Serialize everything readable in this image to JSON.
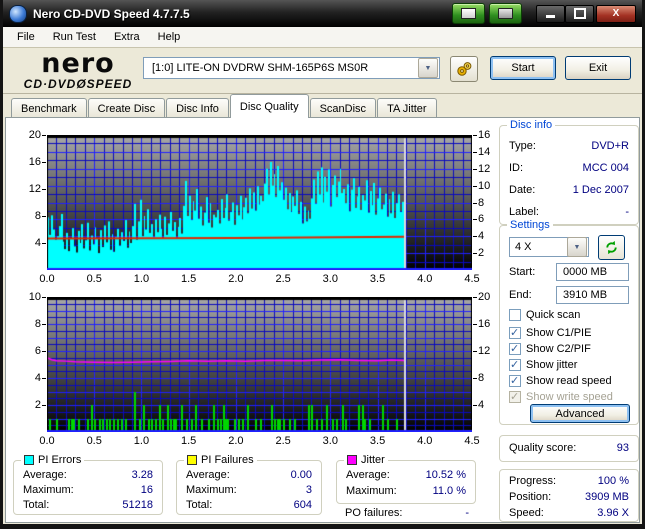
{
  "window": {
    "title": "Nero CD-DVD Speed 4.7.7.5"
  },
  "icons": {
    "app_icon": "nero-disc",
    "titlebar_left": "capture-window-icon",
    "titlebar_right": "save-disk-icon",
    "minimize": "minimize-icon",
    "maximize": "maximize-icon",
    "close": "close-icon",
    "options": "gears-icon",
    "refresh": "refresh-arrows-icon",
    "combo_arrow": "▼"
  },
  "menu": {
    "items": [
      "File",
      "Run Test",
      "Extra",
      "Help"
    ]
  },
  "toolbar": {
    "logo_line1": "nero",
    "logo_line2": "CD·DVDØSPEED",
    "drive": "[1:0]   LITE-ON DVDRW SHM-165P6S MS0R",
    "start_label": "Start",
    "exit_label": "Exit"
  },
  "tabs": {
    "items": [
      "Benchmark",
      "Create Disc",
      "Disc Info",
      "Disc Quality",
      "ScanDisc",
      "TA Jitter"
    ],
    "selected": "Disc Quality"
  },
  "disc_info": {
    "title": "Disc info",
    "rows": [
      {
        "label": "Type:",
        "value": "DVD+R"
      },
      {
        "label": "ID:",
        "value": "MCC 004"
      },
      {
        "label": "Date:",
        "value": "1 Dec 2007"
      },
      {
        "label": "Label:",
        "value": "-"
      }
    ]
  },
  "settings": {
    "title": "Settings",
    "speed_value": "4 X",
    "start_label": "Start:",
    "start_value": "0000 MB",
    "end_label": "End:",
    "end_value": "3910 MB",
    "checkboxes": [
      {
        "label": "Quick scan",
        "checked": false,
        "enabled": true
      },
      {
        "label": "Show C1/PIE",
        "checked": true,
        "enabled": true
      },
      {
        "label": "Show C2/PIF",
        "checked": true,
        "enabled": true
      },
      {
        "label": "Show jitter",
        "checked": true,
        "enabled": true
      },
      {
        "label": "Show read speed",
        "checked": true,
        "enabled": true
      },
      {
        "label": "Show write speed",
        "checked": true,
        "enabled": false
      }
    ],
    "advanced_label": "Advanced"
  },
  "quality": {
    "label": "Quality score:",
    "value": "93"
  },
  "progress": {
    "rows": [
      {
        "label": "Progress:",
        "value": "100 %"
      },
      {
        "label": "Position:",
        "value": "3909 MB"
      },
      {
        "label": "Speed:",
        "value": "3.96 X"
      }
    ]
  },
  "stats": {
    "pi_errors": {
      "title": "PI Errors",
      "swatch": "#00FFFF",
      "rows": [
        [
          "Average:",
          "3.28"
        ],
        [
          "Maximum:",
          "16"
        ],
        [
          "Total:",
          "51218"
        ]
      ]
    },
    "pi_failures": {
      "title": "PI Failures",
      "swatch": "#FFFF00",
      "rows": [
        [
          "Average:",
          "0.00"
        ],
        [
          "Maximum:",
          "3"
        ],
        [
          "Total:",
          "604"
        ]
      ]
    },
    "jitter": {
      "title": "Jitter",
      "swatch": "#FF00FF",
      "rows": [
        [
          "Average:",
          "10.52 %"
        ],
        [
          "Maximum:",
          "11.0 %"
        ]
      ],
      "po_label": "PO failures:",
      "po_value": "-"
    }
  },
  "chart_data": [
    {
      "type": "area",
      "name": "pi-errors-vs-position",
      "xlim": [
        0,
        4.5
      ],
      "x_ticks": [
        0,
        0.5,
        1,
        1.5,
        2,
        2.5,
        3,
        3.5,
        4,
        4.5
      ],
      "ylim_left": [
        0,
        20
      ],
      "left_ticks": [
        4,
        8,
        12,
        16,
        20
      ],
      "ylim_right": [
        0,
        16
      ],
      "right_ticks": [
        2,
        4,
        6,
        8,
        10,
        12,
        14,
        16
      ],
      "grid_rows": 16,
      "grid_cols": 45,
      "bg_top": "#A9A9A9",
      "bg_bottom": "#000000",
      "grid_minor": "#0A0ABE",
      "grid_major": "#2121FF",
      "data_end_x": 3.79,
      "cursor_x": 3.79,
      "cursor_color": "#DCDCDC",
      "series": [
        {
          "name": "PI Errors",
          "render": "fill",
          "axis": "left",
          "color": "#00FFFF",
          "values": [
            7.8,
            5.2,
            8.1,
            6.0,
            4.5,
            5.0,
            6.5,
            8.3,
            4.2,
            3.1,
            5.5,
            2.8,
            4.6,
            6.2,
            3.5,
            2.6,
            5.8,
            4.0,
            6.8,
            3.2,
            4.4,
            7.0,
            2.9,
            5.1,
            3.8,
            6.3,
            4.7,
            2.5,
            5.9,
            3.4,
            6.6,
            4.1,
            7.2,
            3.0,
            5.3,
            2.7,
            4.9,
            6.1,
            3.6,
            5.6,
            4.3,
            7.4,
            3.3,
            5.7,
            4.0,
            6.5,
            9.8,
            4.5,
            7.2,
            10.4,
            5.0,
            8.0,
            6.0,
            9.0,
            5.5,
            6.8,
            4.9,
            7.5,
            5.6,
            8.2,
            6.1,
            4.6,
            7.9,
            5.2,
            6.9,
            8.6,
            5.8,
            7.1,
            4.8,
            6.4,
            7.7,
            5.4,
            9.5,
            13.2,
            8.0,
            11.0,
            7.4,
            10.2,
            8.8,
            12.0,
            7.6,
            9.4,
            6.6,
            8.5,
            10.8,
            7.0,
            9.9,
            6.3,
            8.2,
            7.8,
            8.9,
            6.9,
            10.5,
            7.7,
            9.2,
            11.2,
            7.3,
            8.6,
            10.0,
            6.7,
            9.6,
            8.1,
            11.0,
            7.5,
            9.3,
            10.7,
            8.4,
            12.1,
            9.1,
            11.5,
            8.8,
            12.4,
            9.7,
            11.0,
            10.2,
            12.8,
            15.0,
            11.2,
            16.0,
            12.5,
            14.2,
            10.8,
            15.4,
            11.8,
            13.0,
            10.4,
            12.2,
            9.0,
            11.4,
            8.6,
            10.9,
            9.5,
            11.8,
            8.3,
            10.1,
            6.9,
            9.4,
            7.2,
            8.8,
            7.6,
            10.6,
            13.4,
            9.8,
            14.6,
            11.2,
            15.2,
            10.0,
            13.8,
            11.6,
            14.9,
            9.4,
            12.6,
            14.0,
            10.8,
            13.1,
            15.0,
            11.4,
            12.0,
            9.9,
            12.7,
            8.7,
            11.9,
            13.6,
            9.2,
            10.9,
            12.3,
            8.9,
            11.1,
            10.3,
            13.3,
            8.5,
            11.7,
            9.6,
            12.9,
            8.2,
            10.6,
            12.2,
            9.0,
            9.7,
            11.3,
            7.9,
            10.5,
            8.4,
            11.6,
            7.7,
            9.9,
            11.2,
            8.6,
            10.1,
            11.0
          ]
        },
        {
          "name": "Read speed",
          "render": "line",
          "axis": "right",
          "color": "#E02800",
          "width": 2,
          "points": [
            [
              0,
              3.73
            ],
            [
              2.0,
              3.8
            ],
            [
              3.79,
              3.93
            ]
          ]
        }
      ]
    },
    {
      "type": "bars+line",
      "name": "pi-failures-and-jitter-vs-position",
      "xlim": [
        0,
        4.5
      ],
      "x_ticks": [
        0,
        0.5,
        1,
        1.5,
        2,
        2.5,
        3,
        3.5,
        4,
        4.5
      ],
      "ylim_left": [
        0,
        10
      ],
      "left_ticks": [
        2,
        4,
        6,
        8,
        10
      ],
      "ylim_right": [
        0,
        20
      ],
      "right_ticks": [
        4,
        8,
        12,
        16,
        20
      ],
      "grid_rows": 20,
      "grid_cols": 45,
      "bg_top": "#A9A9A9",
      "bg_bottom": "#000000",
      "grid_minor": "#0A0ABE",
      "grid_major": "#2121FF",
      "data_end_x": 3.79,
      "cursor_x": 3.79,
      "cursor_color": "#DCDCDC",
      "series": [
        {
          "name": "PI Failures",
          "render": "bars",
          "axis": "left",
          "color": "#00D800",
          "bars": [
            [
              0.02,
              1
            ],
            [
              0.1,
              1
            ],
            [
              0.22,
              1
            ],
            [
              0.25,
              1
            ],
            [
              0.28,
              1
            ],
            [
              0.33,
              1
            ],
            [
              0.42,
              1
            ],
            [
              0.47,
              2
            ],
            [
              0.5,
              1
            ],
            [
              0.55,
              1
            ],
            [
              0.58,
              1
            ],
            [
              0.62,
              1
            ],
            [
              0.66,
              1
            ],
            [
              0.7,
              1
            ],
            [
              0.74,
              1
            ],
            [
              0.78,
              1
            ],
            [
              0.83,
              1
            ],
            [
              0.92,
              3
            ],
            [
              0.97,
              1
            ],
            [
              1.02,
              2
            ],
            [
              1.07,
              1
            ],
            [
              1.1,
              1
            ],
            [
              1.14,
              1
            ],
            [
              1.19,
              2
            ],
            [
              1.22,
              1
            ],
            [
              1.27,
              2
            ],
            [
              1.3,
              1
            ],
            [
              1.33,
              1
            ],
            [
              1.36,
              1
            ],
            [
              1.42,
              2
            ],
            [
              1.47,
              1
            ],
            [
              1.52,
              1
            ],
            [
              1.57,
              2
            ],
            [
              1.63,
              1
            ],
            [
              1.7,
              1
            ],
            [
              1.76,
              2
            ],
            [
              1.8,
              1
            ],
            [
              1.83,
              1
            ],
            [
              1.86,
              2
            ],
            [
              1.88,
              1
            ],
            [
              1.91,
              1
            ],
            [
              1.98,
              1
            ],
            [
              2.02,
              1
            ],
            [
              2.06,
              1
            ],
            [
              2.12,
              2
            ],
            [
              2.2,
              1
            ],
            [
              2.26,
              1
            ],
            [
              2.37,
              2
            ],
            [
              2.4,
              1
            ],
            [
              2.43,
              1
            ],
            [
              2.46,
              1
            ],
            [
              2.5,
              1
            ],
            [
              2.56,
              1
            ],
            [
              2.62,
              1
            ],
            [
              2.76,
              2
            ],
            [
              2.79,
              2
            ],
            [
              2.85,
              1
            ],
            [
              2.9,
              1
            ],
            [
              2.95,
              2
            ],
            [
              3.02,
              1
            ],
            [
              3.06,
              1
            ],
            [
              3.12,
              2
            ],
            [
              3.16,
              1
            ],
            [
              3.29,
              2
            ],
            [
              3.33,
              2
            ],
            [
              3.36,
              1
            ],
            [
              3.41,
              1
            ],
            [
              3.55,
              2
            ],
            [
              3.6,
              1
            ],
            [
              3.7,
              1
            ],
            [
              3.78,
              2
            ]
          ]
        },
        {
          "name": "Jitter %",
          "render": "line",
          "axis": "right",
          "color": "#FF00FF",
          "width": 1.5,
          "points": [
            [
              0,
              11.0
            ],
            [
              0.05,
              10.7
            ],
            [
              0.1,
              10.55
            ],
            [
              0.2,
              10.5
            ],
            [
              0.3,
              10.4
            ],
            [
              0.5,
              10.35
            ],
            [
              0.7,
              10.3
            ],
            [
              0.9,
              10.35
            ],
            [
              1.1,
              10.4
            ],
            [
              1.3,
              10.45
            ],
            [
              1.5,
              10.55
            ],
            [
              1.7,
              10.5
            ],
            [
              1.9,
              10.55
            ],
            [
              2.1,
              10.5
            ],
            [
              2.3,
              10.6
            ],
            [
              2.5,
              10.6
            ],
            [
              2.7,
              10.55
            ],
            [
              2.9,
              10.65
            ],
            [
              3.1,
              10.7
            ],
            [
              3.3,
              10.6
            ],
            [
              3.5,
              10.55
            ],
            [
              3.65,
              10.65
            ],
            [
              3.79,
              10.6
            ]
          ]
        }
      ]
    }
  ]
}
